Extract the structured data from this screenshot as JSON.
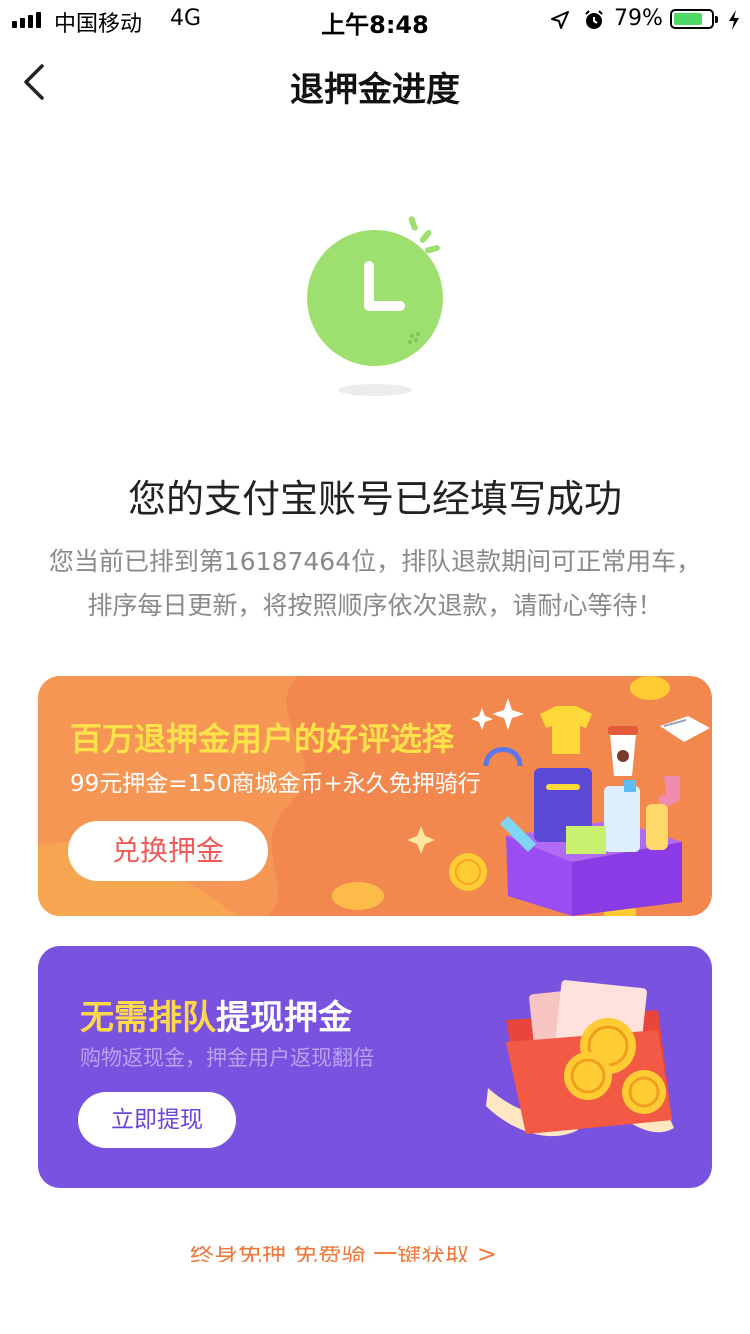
{
  "status_bar": {
    "carrier": "中国移动",
    "network": "4G",
    "time": "上午8:48",
    "battery": "79%",
    "battery_level": 0.79
  },
  "nav": {
    "title": "退押金进度"
  },
  "main": {
    "headline": "您的支付宝账号已经填写成功",
    "description_line1": "您当前已排到第16187464位，排队退款期间可正常用车，",
    "description_line2": "排序每日更新，将按照顺序依次退款，请耐心等待！"
  },
  "banner1": {
    "title": "百万退押金用户的好评选择",
    "subtitle": "99元押金=150商城金币+永久免押骑行",
    "button": "兑换押金"
  },
  "banner2": {
    "title_highlight": "无需排队",
    "title_rest": "提现押金",
    "subtitle": "购物返现金，押金用户返现翻倍",
    "button": "立即提现"
  },
  "footer": {
    "link_text": "终身免押 免费骑 一键获取 >"
  },
  "colors": {
    "clock_green": "#9ee06f",
    "banner1_bg": "#f2884e",
    "banner1_title": "#ffe24a",
    "banner2_bg": "#7a52e0",
    "banner2_highlight": "#ffd84a",
    "link_orange": "#f07a3c"
  }
}
